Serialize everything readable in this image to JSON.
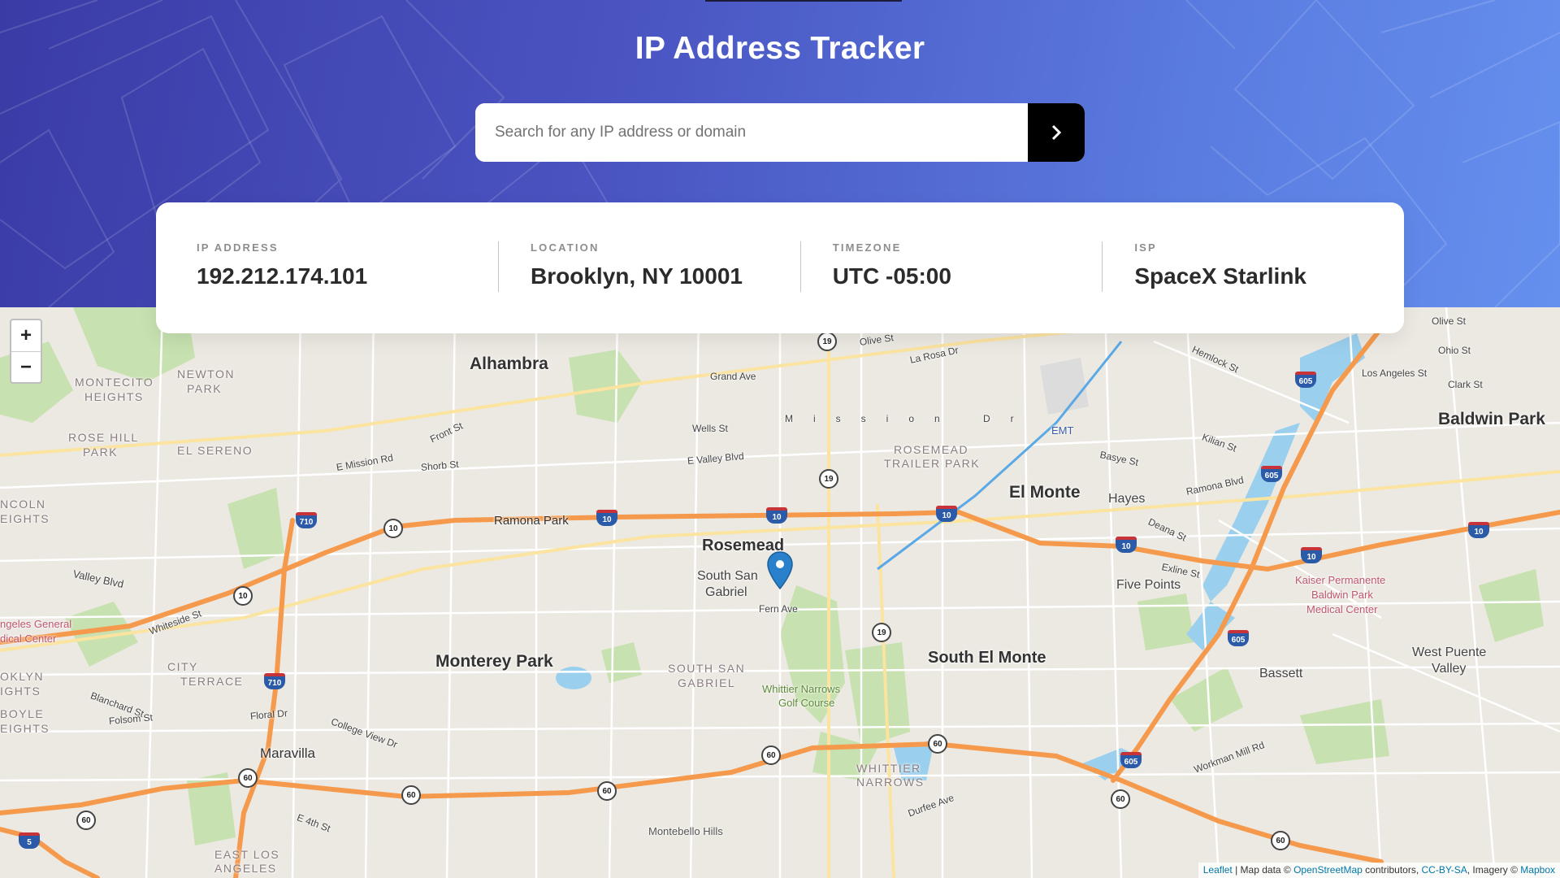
{
  "header": {
    "title": "IP Address Tracker",
    "search_placeholder": "Search for any IP address or domain",
    "search_value": ""
  },
  "info": [
    {
      "label": "IP Address",
      "value": "192.212.174.101"
    },
    {
      "label": "Location",
      "value": "Brooklyn, NY 10001"
    },
    {
      "label": "Timezone",
      "value": "UTC -05:00"
    },
    {
      "label": "ISP",
      "value": "SpaceX Starlink"
    }
  ],
  "map": {
    "zoom_in": "+",
    "zoom_out": "−",
    "attribution": {
      "leaflet": "Leaflet",
      "sep": " | Map data © ",
      "osm": "OpenStreetMap",
      "contrib": " contributors, ",
      "license": "CC-BY-SA",
      "imagery": ", Imagery © ",
      "mapbox": "Mapbox"
    },
    "labels": {
      "alhambra": "Alhambra",
      "rosemead": "Rosemead",
      "south_san_gabriel_1": "South San",
      "south_san_gabriel_2": "Gabriel",
      "monterey_park": "Monterey Park",
      "el_monte": "El Monte",
      "south_el_monte": "South El Monte",
      "baldwin_park": "Baldwin Park",
      "hayes": "Hayes",
      "five_points": "Five Points",
      "bassett": "Bassett",
      "west_puente_1": "West Puente",
      "west_puente_2": "Valley",
      "maravilla": "Maravilla",
      "monterey_park_hood": "MONTECITO",
      "monterey_park_hood2": "HEIGHTS",
      "newton_park_1": "NEWTON",
      "newton_park_2": "PARK",
      "rose_hill_1": "ROSE HILL",
      "rose_hill_2": "PARK",
      "el_sereno": "EL SERENO",
      "city_terrace_1": "CITY",
      "city_terrace_2": "TERRACE",
      "south_san_gabriel_caps_1": "SOUTH SAN",
      "south_san_gabriel_caps_2": "GABRIEL",
      "rosemead_trailer_1": "ROSEMEAD",
      "rosemead_trailer_2": "TRAILER PARK",
      "whittier_narrows_1": "WHITTIER",
      "whittier_narrows_2": "NARROWS",
      "whittier_golf_1": "Whittier Narrows",
      "whittier_golf_2": "Golf Course",
      "kaiser_1": "Kaiser Permanente",
      "kaiser_2": "Baldwin Park",
      "kaiser_3": "Medical Center",
      "east_la_1": "EAST LOS",
      "east_la_2": "ANGELES",
      "montebello_hills": "Montebello Hills",
      "emt": "EMT",
      "fern_ave": "Fern Ave",
      "ramona_park": "Ramona Park",
      "grand_ave": "Grand Ave",
      "mission_dr": "Mission Dr",
      "wells_st": "Wells St",
      "valley_blvd": "E Valley Blvd",
      "la_rosa": "La Rosa Dr",
      "olive_st": "Olive St",
      "olive_st2": "Olive St",
      "ohio_st": "Ohio St",
      "los_angeles_st": "Los Angeles St",
      "clark_st": "Clark St",
      "hemlock_st": "Hemlock St",
      "ramona_blvd": "Ramona Blvd",
      "exline_st": "Exline St",
      "durfee_ave": "Durfee Ave",
      "workman_mill": "Workman Mill Rd",
      "front_st": "Front St",
      "shorb_st": "Shorb St",
      "e_mission_rd": "E Mission Rd",
      "whiteside_st": "Whiteside St",
      "floral_dr": "Floral Dr",
      "college_view": "College View Dr",
      "blanchard_st": "Blanchard St",
      "folsom_st": "Folsom St",
      "e_4th_st": "E 4th St",
      "valley_blvd_w": "Valley Blvd",
      "kilian_st": "Kilian St",
      "basye_st": "Basye St",
      "deana_st": "Deana St",
      "la_general_1": "ngeles General",
      "la_general_2": "dical Center",
      "lincoln_1": "NCOLN",
      "lincoln_2": "EIGHTS",
      "boyle_1": "BOYLE",
      "boyle_2": "EIGHTS",
      "brooklyn_1": "OKLYN",
      "brooklyn_2": "IGHTS"
    },
    "shields": {
      "i10": "10",
      "i710": "710",
      "i605": "605",
      "i5": "5",
      "r19": "19",
      "r60": "60"
    }
  }
}
